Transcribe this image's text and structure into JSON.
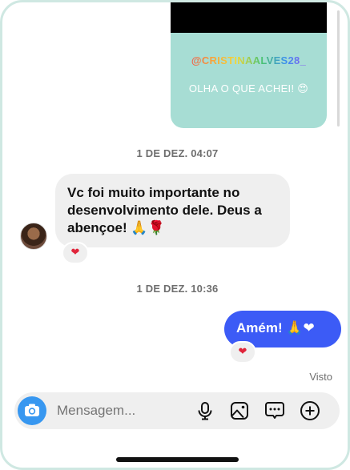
{
  "story": {
    "username": "@CRISTINAALVES28_",
    "caption": "OLHA O QUE ACHEI!",
    "caption_emoji": "😍"
  },
  "timestamps": [
    "1 DE DEZ. 04:07",
    "1 DE DEZ. 10:36"
  ],
  "messages": [
    {
      "direction": "incoming",
      "text_lines": [
        "Vc foi muito importante no",
        "desenvolvimento dele. Deus a",
        "abençoe!"
      ],
      "emojis": "🙏🌹",
      "reaction": "❤"
    },
    {
      "direction": "outgoing",
      "text": "Amém!",
      "emojis": "🙏❤",
      "reaction": "❤"
    }
  ],
  "seen_status": "Visto",
  "composer": {
    "placeholder": "Mensagem...",
    "icons": [
      "camera-icon",
      "microphone-icon",
      "gallery-icon",
      "sticker-icon",
      "add-icon"
    ]
  },
  "colors": {
    "outgoing_bubble": "#3c5bf6",
    "incoming_bubble": "#efefef",
    "story_background": "#a7ddd4",
    "camera_button": "#3797f0",
    "reaction_heart": "#e0243a"
  }
}
